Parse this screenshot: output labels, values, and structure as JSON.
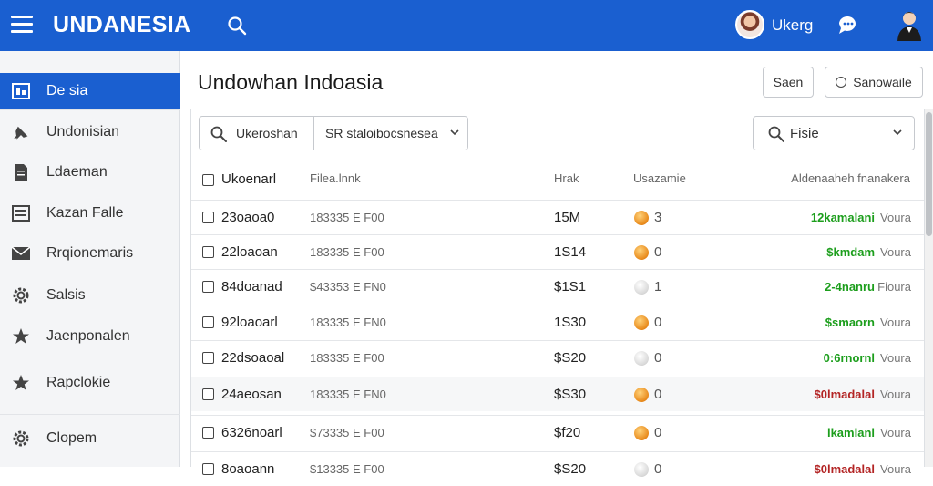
{
  "app": {
    "brand": "UNDANESIA",
    "user_name": "Ukerg"
  },
  "sidebar": {
    "items": [
      {
        "label": "De sia",
        "icon": "dashboard-icon",
        "active": true
      },
      {
        "label": "Undonisian",
        "icon": "pin-icon",
        "active": false
      },
      {
        "label": "Ldaeman",
        "icon": "document-icon",
        "active": false
      },
      {
        "label": "Kazan Falle",
        "icon": "list-icon",
        "active": false
      },
      {
        "label": "Rrqionemaris",
        "icon": "mail-icon",
        "active": false
      },
      {
        "label": "Salsis",
        "icon": "gear-icon",
        "active": false
      },
      {
        "label": "Jaenponalen",
        "icon": "star-icon",
        "active": false
      },
      {
        "label": "Rapclokie",
        "icon": "star-icon",
        "active": false
      },
      {
        "label": "Clopem",
        "icon": "gear-icon",
        "active": false
      }
    ]
  },
  "main": {
    "title": "Undowhan Indoasia",
    "save_label": "Saen",
    "save_mode_label": "Sanowaile",
    "search_value": "Ukeroshan",
    "search_select": "SR staloibocsnesea",
    "filter_value": "Fisie"
  },
  "table": {
    "headers": [
      "Ukoenarl",
      "Filea.lnnk",
      "Hrak",
      "Usazamie",
      "Aldenaaheh fnanakera"
    ],
    "rows": [
      {
        "name": "23oaoa0",
        "file": "183335 E F00",
        "mark": "15M",
        "dot": "orange",
        "score": "3",
        "status": "12kamalani",
        "status_color": "#1c9e1c",
        "sub": "Voura"
      },
      {
        "name": "22loaoan",
        "file": "183335 E F00",
        "mark": "1S14",
        "dot": "orange",
        "score": "0",
        "status": "$kmdam",
        "status_color": "#1c9e1c",
        "sub": "Voura"
      },
      {
        "name": "84doanad",
        "file": "$43353 E FN0",
        "mark": "$1S1",
        "dot": "gray",
        "score": "1",
        "status": "2-4nanru",
        "status_color": "#1c9e1c",
        "sub": "Fioura"
      },
      {
        "name": "92loaoarl",
        "file": "183335 E FN0",
        "mark": "1S30",
        "dot": "orange",
        "score": "0",
        "status": "$smaorn",
        "status_color": "#1c9e1c",
        "sub": "Voura"
      },
      {
        "name": "22dsoaoal",
        "file": "183335 E F00",
        "mark": "$S20",
        "dot": "gray",
        "score": "0",
        "status": "0:6rnornl",
        "status_color": "#1c9e1c",
        "sub": "Voura"
      },
      {
        "name": "24aeosan",
        "file": "183335 E FN0",
        "mark": "$S30",
        "dot": "orange",
        "score": "0",
        "status": "$0lmadalal",
        "status_color": "#b32424",
        "sub": "Voura"
      },
      {
        "name": "6326noarl",
        "file": "$73335 E F00",
        "mark": "$f20",
        "dot": "orange",
        "score": "0",
        "status": "lkamlanl",
        "status_color": "#1c9e1c",
        "sub": "Voura"
      },
      {
        "name": "8oaoann",
        "file": "$13335 E F00",
        "mark": "$S20",
        "dot": "gray",
        "score": "0",
        "status": "$0lmadalal",
        "status_color": "#b32424",
        "sub": "Voura"
      }
    ]
  }
}
